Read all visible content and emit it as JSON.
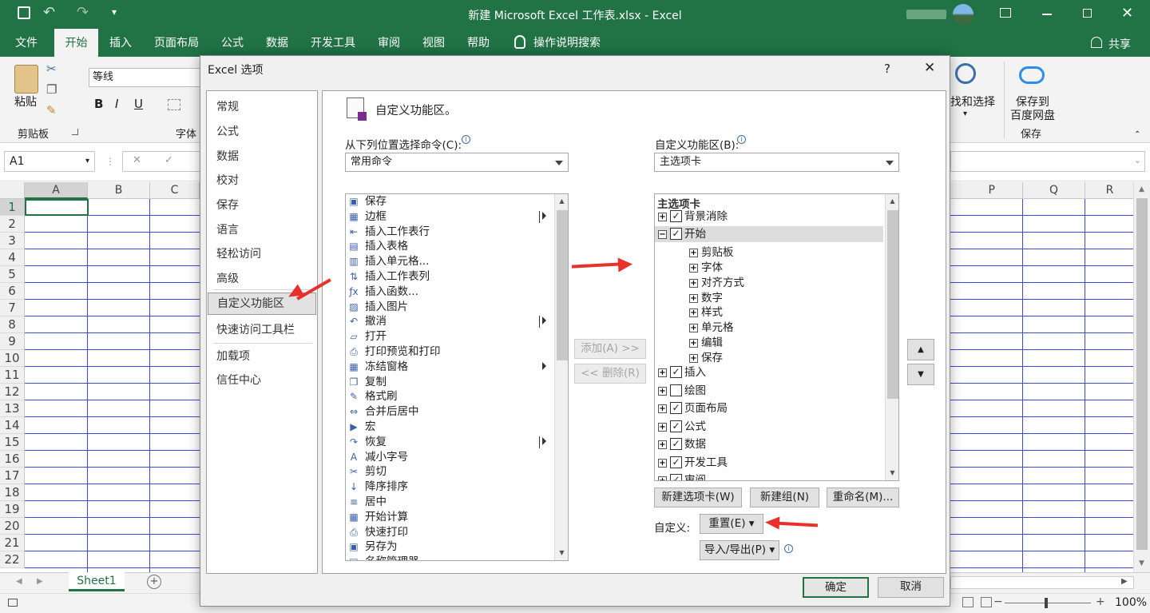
{
  "window": {
    "title": "新建 Microsoft Excel 工作表.xlsx  -  Excel"
  },
  "ribbon_tabs": [
    {
      "label": "文件"
    },
    {
      "label": "开始"
    },
    {
      "label": "插入"
    },
    {
      "label": "页面布局"
    },
    {
      "label": "公式"
    },
    {
      "label": "数据"
    },
    {
      "label": "开发工具"
    },
    {
      "label": "审阅"
    },
    {
      "label": "视图"
    },
    {
      "label": "帮助"
    },
    {
      "label": "操作说明搜索"
    }
  ],
  "share_label": "共享",
  "ribbon": {
    "paste_label": "粘贴",
    "clipboard_group": "剪贴板",
    "font_name": "等线",
    "font_group": "字体",
    "find_select": "找和选择",
    "save_to_cloud_1": "保存到",
    "save_to_cloud_2": "百度网盘",
    "save_group": "保存"
  },
  "formula_bar": {
    "name_box": "A1"
  },
  "columns_left": [
    "A",
    "B",
    "C"
  ],
  "columns_right": [
    "P",
    "Q",
    "R"
  ],
  "rows": [
    "1",
    "2",
    "3",
    "4",
    "5",
    "6",
    "7",
    "8",
    "9",
    "10",
    "11",
    "12",
    "13",
    "14",
    "15",
    "16",
    "17",
    "18",
    "19",
    "20",
    "21",
    "22"
  ],
  "sheet_tab": "Sheet1",
  "status": {
    "zoom": "100%"
  },
  "dialog": {
    "title": "Excel 选项",
    "help": "?",
    "close": "✕",
    "categories": [
      "常规",
      "公式",
      "数据",
      "校对",
      "保存",
      "语言",
      "轻松访问",
      "高级",
      "自定义功能区",
      "快速访问工具栏",
      "加载项",
      "信任中心"
    ],
    "selected_category": "自定义功能区",
    "heading": "自定义功能区。",
    "choose_from_label": "从下列位置选择命令(C):",
    "choose_from_value": "常用命令",
    "customize_label": "自定义功能区(B):",
    "customize_value": "主选项卡",
    "commands": [
      {
        "label": "保存",
        "icon": "save-icon",
        "glyph": "▣"
      },
      {
        "label": "边框",
        "icon": "border-icon",
        "glyph": "▦",
        "submenu": true
      },
      {
        "label": "插入工作表行",
        "icon": "insert-row-icon",
        "glyph": "⇤"
      },
      {
        "label": "插入表格",
        "icon": "table-icon",
        "glyph": "▤"
      },
      {
        "label": "插入单元格...",
        "icon": "insert-cell-icon",
        "glyph": "▥"
      },
      {
        "label": "插入工作表列",
        "icon": "insert-column-icon",
        "glyph": "⇅"
      },
      {
        "label": "插入函数...",
        "icon": "function-icon",
        "glyph": "ƒx"
      },
      {
        "label": "插入图片",
        "icon": "picture-icon",
        "glyph": "▨"
      },
      {
        "label": "撤消",
        "icon": "undo-icon",
        "glyph": "↶",
        "submenu": true
      },
      {
        "label": "打开",
        "icon": "folder-icon",
        "glyph": "▱"
      },
      {
        "label": "打印预览和打印",
        "icon": "print-preview-icon",
        "glyph": "⎙"
      },
      {
        "label": "冻结窗格",
        "icon": "freeze-panes-icon",
        "glyph": "▦",
        "submenu": true
      },
      {
        "label": "复制",
        "icon": "copy-icon",
        "glyph": "❐"
      },
      {
        "label": "格式刷",
        "icon": "format-painter-icon",
        "glyph": "✎"
      },
      {
        "label": "合并后居中",
        "icon": "merge-center-icon",
        "glyph": "⇔"
      },
      {
        "label": "宏",
        "icon": "macro-icon",
        "glyph": "▶"
      },
      {
        "label": "恢复",
        "icon": "redo-icon",
        "glyph": "↷",
        "submenu": true
      },
      {
        "label": "减小字号",
        "icon": "decrease-font-icon",
        "glyph": "A"
      },
      {
        "label": "剪切",
        "icon": "cut-icon",
        "glyph": "✂"
      },
      {
        "label": "降序排序",
        "icon": "sort-desc-icon",
        "glyph": "↓"
      },
      {
        "label": "居中",
        "icon": "center-align-icon",
        "glyph": "≡"
      },
      {
        "label": "开始计算",
        "icon": "calculate-icon",
        "glyph": "▦"
      },
      {
        "label": "快速打印",
        "icon": "quick-print-icon",
        "glyph": "⎙"
      },
      {
        "label": "另存为",
        "icon": "save-as-icon",
        "glyph": "▣"
      },
      {
        "label": "名称管理器",
        "icon": "name-manager-icon",
        "glyph": "▤"
      }
    ],
    "tree_header": "主选项卡",
    "tree": [
      {
        "label": "背景消除",
        "level": 0,
        "expand": "+",
        "checked": true
      },
      {
        "label": "开始",
        "level": 0,
        "expand": "−",
        "checked": true,
        "highlight": true
      },
      {
        "label": "剪贴板",
        "level": 1,
        "expand": "+"
      },
      {
        "label": "字体",
        "level": 1,
        "expand": "+"
      },
      {
        "label": "对齐方式",
        "level": 1,
        "expand": "+"
      },
      {
        "label": "数字",
        "level": 1,
        "expand": "+"
      },
      {
        "label": "样式",
        "level": 1,
        "expand": "+"
      },
      {
        "label": "单元格",
        "level": 1,
        "expand": "+"
      },
      {
        "label": "编辑",
        "level": 1,
        "expand": "+"
      },
      {
        "label": "保存",
        "level": 1,
        "expand": "+"
      },
      {
        "label": "插入",
        "level": 0,
        "expand": "+",
        "checked": true
      },
      {
        "label": "绘图",
        "level": 0,
        "expand": "+",
        "checked": false
      },
      {
        "label": "页面布局",
        "level": 0,
        "expand": "+",
        "checked": true
      },
      {
        "label": "公式",
        "level": 0,
        "expand": "+",
        "checked": true
      },
      {
        "label": "数据",
        "level": 0,
        "expand": "+",
        "checked": true
      },
      {
        "label": "开发工具",
        "level": 0,
        "expand": "+",
        "checked": true
      },
      {
        "label": "审阅",
        "level": 0,
        "expand": "+",
        "checked": true
      }
    ],
    "add_button": "添加(A) >>",
    "remove_button": "<< 删除(R)",
    "new_tab_button": "新建选项卡(W)",
    "new_group_button": "新建组(N)",
    "rename_button": "重命名(M)...",
    "customize_label2": "自定义:",
    "reset_button": "重置(E) ▾",
    "import_export_button": "导入/导出(P) ▾",
    "ok_button": "确定",
    "cancel_button": "取消"
  },
  "colors": {
    "excel_green": "#217346",
    "arrow_red": "#e8312a",
    "grid_line": "#3b4bd8"
  }
}
